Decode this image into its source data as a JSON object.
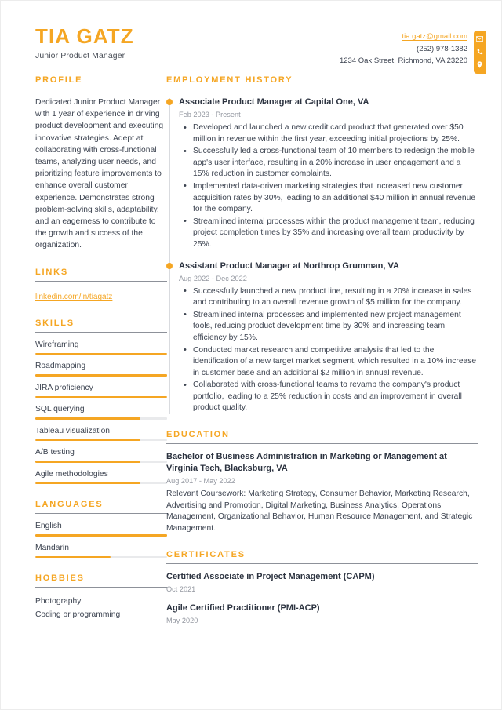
{
  "theme": {
    "accent": "#F5A623",
    "text": "#3c4350",
    "heading_text": "#2c3340",
    "muted": "#9498a1",
    "rule": "#8d9199",
    "bar_track": "#e9eaec",
    "page_bg": "#ffffff"
  },
  "header": {
    "full_name": "TIA GATZ",
    "job_title": "Junior Product Manager",
    "contact": {
      "email": "tia.gatz@gmail.com",
      "phone": "(252) 978-1382",
      "address": "1234 Oak Street, Richmond, VA 23220",
      "icons": [
        "envelope-icon",
        "phone-icon",
        "location-pin-icon"
      ]
    }
  },
  "sidebar": {
    "profile": {
      "heading": "PROFILE",
      "text": "Dedicated Junior Product Manager with 1 year of experience in driving product development and executing innovative strategies. Adept at collaborating with cross-functional teams, analyzing user needs, and prioritizing feature improvements to enhance overall customer experience. Demonstrates strong problem-solving skills, adaptability, and an eagerness to contribute to the growth and success of the organization."
    },
    "links": {
      "heading": "LINKS",
      "items": [
        {
          "label": "linkedin.com/in/tiagatz"
        }
      ]
    },
    "skills": {
      "heading": "SKILLS",
      "items": [
        {
          "label": "Wireframing",
          "level": 100
        },
        {
          "label": "Roadmapping",
          "level": 100
        },
        {
          "label": "JIRA proficiency",
          "level": 100
        },
        {
          "label": "SQL querying",
          "level": 80
        },
        {
          "label": "Tableau visualization",
          "level": 80
        },
        {
          "label": "A/B testing",
          "level": 80
        },
        {
          "label": "Agile methodologies",
          "level": 80
        }
      ]
    },
    "languages": {
      "heading": "LANGUAGES",
      "items": [
        {
          "label": "English",
          "level": 100
        },
        {
          "label": "Mandarin",
          "level": 57
        }
      ]
    },
    "hobbies": {
      "heading": "HOBBIES",
      "items": [
        {
          "label": "Photography"
        },
        {
          "label": "Coding or programming"
        }
      ]
    }
  },
  "main": {
    "employment": {
      "heading": "EMPLOYMENT HISTORY",
      "jobs": [
        {
          "title": "Associate Product Manager at Capital One, VA",
          "dates": "Feb 2023 - Present",
          "bullets": [
            "Developed and launched a new credit card product that generated over $50 million in revenue within the first year, exceeding initial projections by 25%.",
            "Successfully led a cross-functional team of 10 members to redesign the mobile app's user interface, resulting in a 20% increase in user engagement and a 15% reduction in customer complaints.",
            "Implemented data-driven marketing strategies that increased new customer acquisition rates by 30%, leading to an additional $40 million in annual revenue for the company.",
            "Streamlined internal processes within the product management team, reducing project completion times by 35% and increasing overall team productivity by 25%."
          ]
        },
        {
          "title": "Assistant Product Manager at Northrop Grumman, VA",
          "dates": "Aug 2022 - Dec 2022",
          "bullets": [
            "Successfully launched a new product line, resulting in a 20% increase in sales and contributing to an overall revenue growth of $5 million for the company.",
            "Streamlined internal processes and implemented new project management tools, reducing product development time by 30% and increasing team efficiency by 15%.",
            "Conducted market research and competitive analysis that led to the identification of a new target market segment, which resulted in a 10% increase in customer base and an additional $2 million in annual revenue.",
            "Collaborated with cross-functional teams to revamp the company's product portfolio, leading to a 25% reduction in costs and an improvement in overall product quality."
          ]
        }
      ]
    },
    "education": {
      "heading": "EDUCATION",
      "entries": [
        {
          "title": "Bachelor of Business Administration in Marketing or Management at Virginia Tech, Blacksburg, VA",
          "dates": "Aug 2017 - May 2022",
          "description": "Relevant Coursework: Marketing Strategy, Consumer Behavior, Marketing Research, Advertising and Promotion, Digital Marketing, Business Analytics, Operations Management, Organizational Behavior, Human Resource Management, and Strategic Management."
        }
      ]
    },
    "certificates": {
      "heading": "CERTIFICATES",
      "entries": [
        {
          "title": "Certified Associate in Project Management (CAPM)",
          "date": "Oct 2021"
        },
        {
          "title": "Agile Certified Practitioner (PMI-ACP)",
          "date": "May 2020"
        }
      ]
    }
  }
}
